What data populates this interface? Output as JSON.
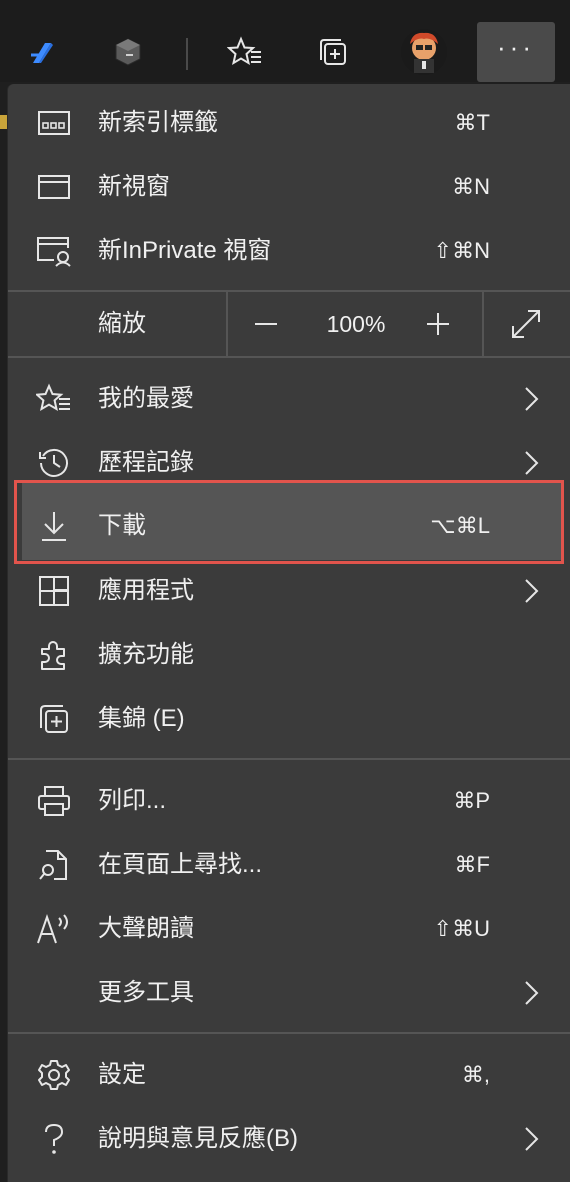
{
  "toolbar": {
    "icons": [
      "edge-pen-icon",
      "extension-cube-icon",
      "favorites-icon",
      "collections-icon",
      "profile-avatar",
      "more-options-icon"
    ],
    "more_label": "···"
  },
  "menu": {
    "new_tab": {
      "label": "新索引標籤",
      "shortcut": "⌘T"
    },
    "new_window": {
      "label": "新視窗",
      "shortcut": "⌘N"
    },
    "new_private_window": {
      "label": "新InPrivate 視窗",
      "shortcut": "⇧⌘N"
    },
    "zoom": {
      "label": "縮放",
      "minus": "−",
      "value": "100%",
      "plus": "+"
    },
    "favorites": {
      "label": "我的最愛"
    },
    "history": {
      "label": "歷程記錄"
    },
    "downloads": {
      "label": "下載",
      "shortcut": "⌥⌘L"
    },
    "apps": {
      "label": "應用程式"
    },
    "extensions": {
      "label": "擴充功能"
    },
    "collections": {
      "label": "集錦 (E)"
    },
    "print": {
      "label": "列印...",
      "shortcut": "⌘P"
    },
    "find": {
      "label": "在頁面上尋找...",
      "shortcut": "⌘F"
    },
    "read_aloud": {
      "label": "大聲朗讀",
      "shortcut": "⇧⌘U"
    },
    "more_tools": {
      "label": "更多工具"
    },
    "settings": {
      "label": "設定",
      "shortcut": "⌘,"
    },
    "help": {
      "label": "說明與意見反應(B)"
    }
  },
  "colors": {
    "menu_bg": "#3b3b3b",
    "highlight_bg": "#555555",
    "highlight_border": "#e2544c",
    "accent_blue": "#3d8bff"
  }
}
